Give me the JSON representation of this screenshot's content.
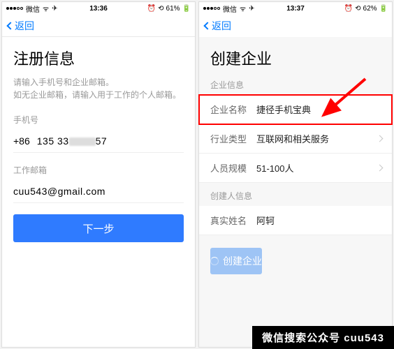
{
  "left": {
    "status": {
      "carrier": "微信",
      "time": "13:36",
      "alarm": "⏰",
      "battery": "61%"
    },
    "nav": {
      "back": "返回"
    },
    "title": "注册信息",
    "subtitle_line1": "请输入手机号和企业邮箱。",
    "subtitle_line2": "如无企业邮箱，请输入用于工作的个人邮箱。",
    "phone_label": "手机号",
    "phone_prefix": "+86",
    "phone_value_a": "135 33",
    "phone_value_b": "57",
    "email_label": "工作邮箱",
    "email_value": "cuu543@gmail.com",
    "next_button": "下一步"
  },
  "right": {
    "status": {
      "carrier": "微信",
      "time": "13:37",
      "alarm": "⏰",
      "battery": "62%"
    },
    "nav": {
      "back": "返回"
    },
    "title": "创建企业",
    "section_company": "企业信息",
    "rows": {
      "name_label": "企业名称",
      "name_value": "捷径手机宝典",
      "industry_label": "行业类型",
      "industry_value": "互联网和相关服务",
      "scale_label": "人员规模",
      "scale_value": "51-100人"
    },
    "section_creator": "创建人信息",
    "creator": {
      "name_label": "真实姓名",
      "name_value": "阿轲"
    },
    "submit_button": "创建企业"
  },
  "banner": "微信搜索公众号 cuu543"
}
